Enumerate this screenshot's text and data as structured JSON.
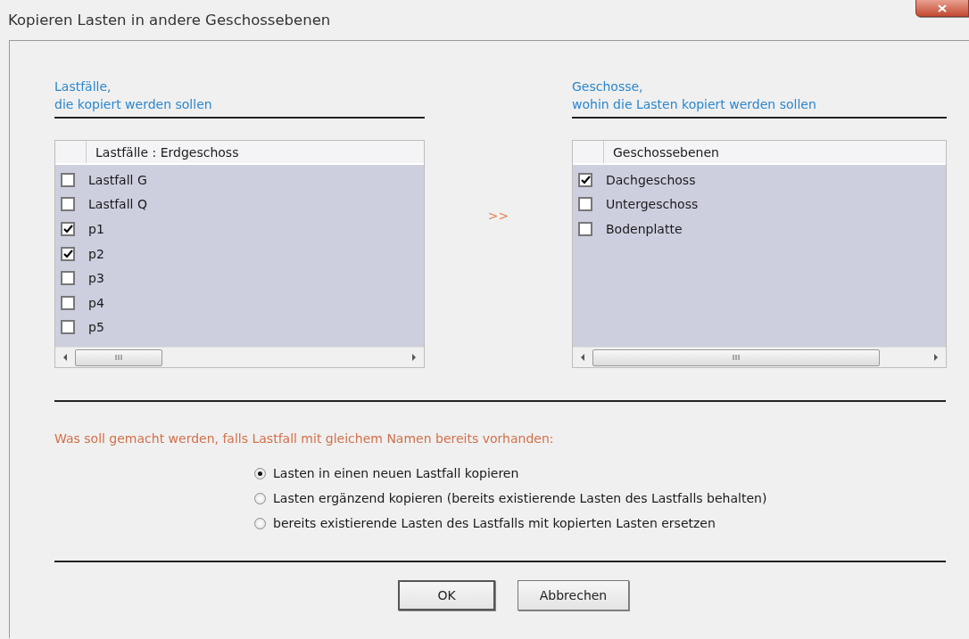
{
  "window": {
    "title": "Kopieren Lasten in andere Geschossebenen"
  },
  "left": {
    "caption": [
      "Lastfälle,",
      "die kopiert werden sollen"
    ],
    "column": "Lastfälle : Erdgeschoss",
    "items": [
      {
        "label": "Lastfall G",
        "checked": false
      },
      {
        "label": "Lastfall Q",
        "checked": false
      },
      {
        "label": "p1",
        "checked": true
      },
      {
        "label": "p2",
        "checked": true
      },
      {
        "label": "p3",
        "checked": false
      },
      {
        "label": "p4",
        "checked": false
      },
      {
        "label": "p5",
        "checked": false
      }
    ]
  },
  "arrow": ">>",
  "right": {
    "caption": [
      "Geschosse,",
      "wohin die Lasten kopiert werden sollen"
    ],
    "column": "Geschossebenen",
    "items": [
      {
        "label": "Dachgeschoss",
        "checked": true
      },
      {
        "label": "Untergeschoss",
        "checked": false
      },
      {
        "label": "Bodenplatte",
        "checked": false
      }
    ]
  },
  "question": "Was soll gemacht werden, falls Lastfall mit gleichem Namen bereits vorhanden:",
  "options": [
    {
      "label": "Lasten in einen neuen Lastfall kopieren",
      "selected": true
    },
    {
      "label": "Lasten ergänzend kopieren (bereits existierende Lasten des Lastfalls behalten)",
      "selected": false
    },
    {
      "label": "bereits existierende Lasten des Lastfalls mit kopierten Lasten ersetzen",
      "selected": false
    }
  ],
  "buttons": [
    "OK",
    "Abbrechen"
  ]
}
